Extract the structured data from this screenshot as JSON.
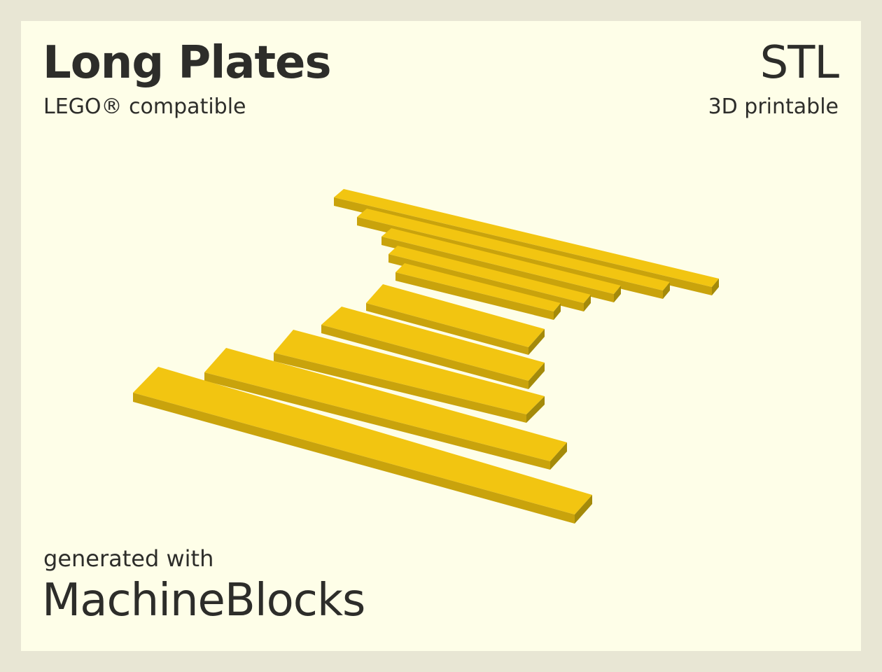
{
  "header": {
    "title": "Long Plates",
    "subtitle": "LEGO® compatible",
    "format": "STL",
    "format_subtitle": "3D printable"
  },
  "footer": {
    "generated_with": "generated with",
    "brand": "MachineBlocks"
  },
  "colors": {
    "background": "#e8e6d4",
    "card": "#fefee8",
    "text": "#2d2d2a",
    "plate_top": "#f2c511",
    "plate_side": "#a48a0a",
    "plate_front": "#c9a30c"
  }
}
